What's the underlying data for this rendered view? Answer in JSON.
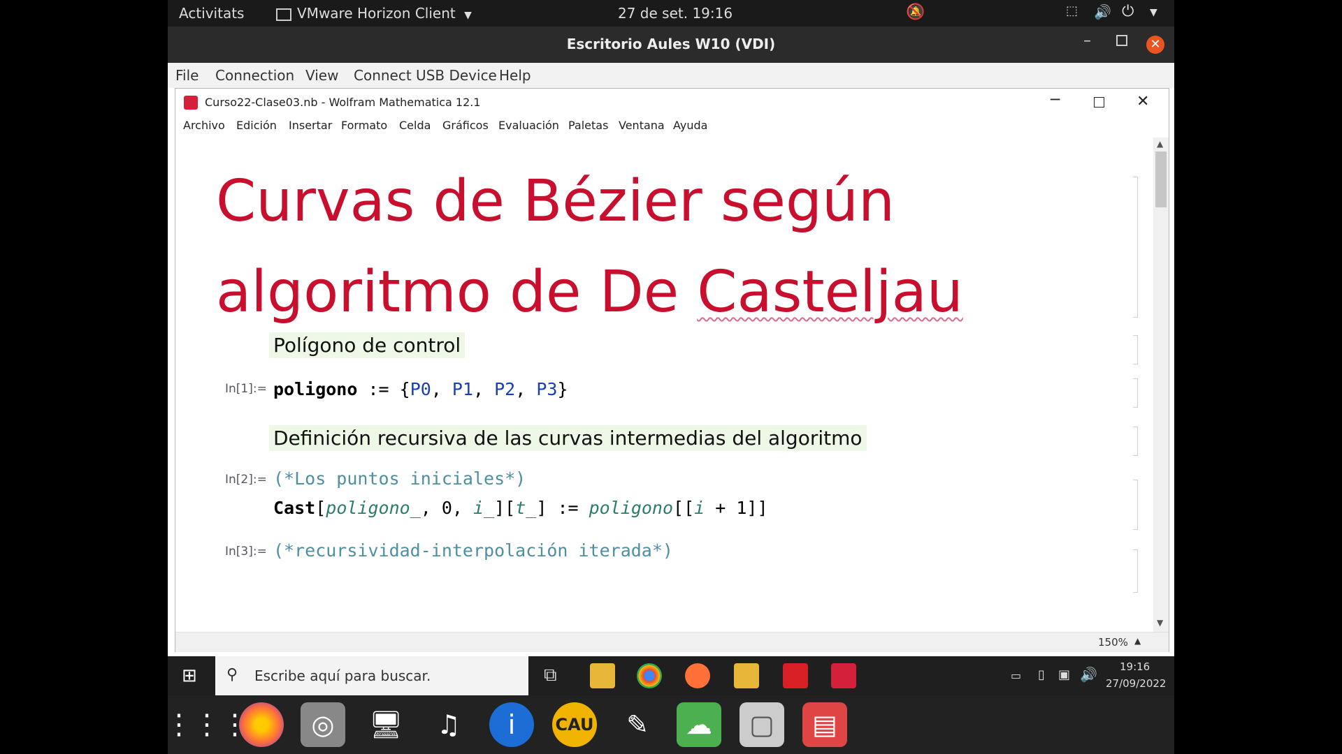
{
  "topbar": {
    "activities": "Activitats",
    "app": "VMware Horizon Client",
    "clock": "27 de set.  19:16"
  },
  "horizon": {
    "window_title": "Escritorio Aules W10 (VDI)",
    "menu": [
      "File",
      "Connection",
      "View",
      "Connect USB Device",
      "Help"
    ]
  },
  "mathematica": {
    "window_title": "Curso22-Clase03.nb - Wolfram Mathematica 12.1",
    "menu": [
      "Archivo",
      "Edición",
      "Insertar",
      "Formato",
      "Celda",
      "Gráficos",
      "Evaluación",
      "Paletas",
      "Ventana",
      "Ayuda"
    ],
    "zoom": "150%"
  },
  "notebook": {
    "title_line1": "Curvas de Bézier según",
    "title_line2_a": "algoritmo de De ",
    "title_line2_b": "Casteljau",
    "section1": "Polígono de control",
    "in1_label": "In[1]:=",
    "in1": {
      "name": "poligono",
      "op": " := {",
      "p0": "P0",
      "sep": ", ",
      "p1": "P1",
      "p2": "P2",
      "p3": "P3",
      "close": "}"
    },
    "section2": "Definición recursiva de las curvas intermedias del algoritmo",
    "in2_label": "In[2]:=",
    "in2_comment": "(*Los puntos iniciales*)",
    "in2_code": {
      "fn": "Cast",
      "lb": "[",
      "a1": "poligono_",
      "c1": ", 0, ",
      "a2": "i_",
      "rb": "][",
      "a3": "t_",
      "def": "] := ",
      "a4": "poligono",
      "idx": "[[",
      "i": "i",
      "plus": " + 1]]"
    },
    "in3_label": "In[3]:=",
    "in3_comment": "(*recursividad-interpolación iterada*)"
  },
  "taskbar": {
    "search_placeholder": "Escribe aquí para buscar.",
    "time": "19:16",
    "date": "27/09/2022"
  }
}
